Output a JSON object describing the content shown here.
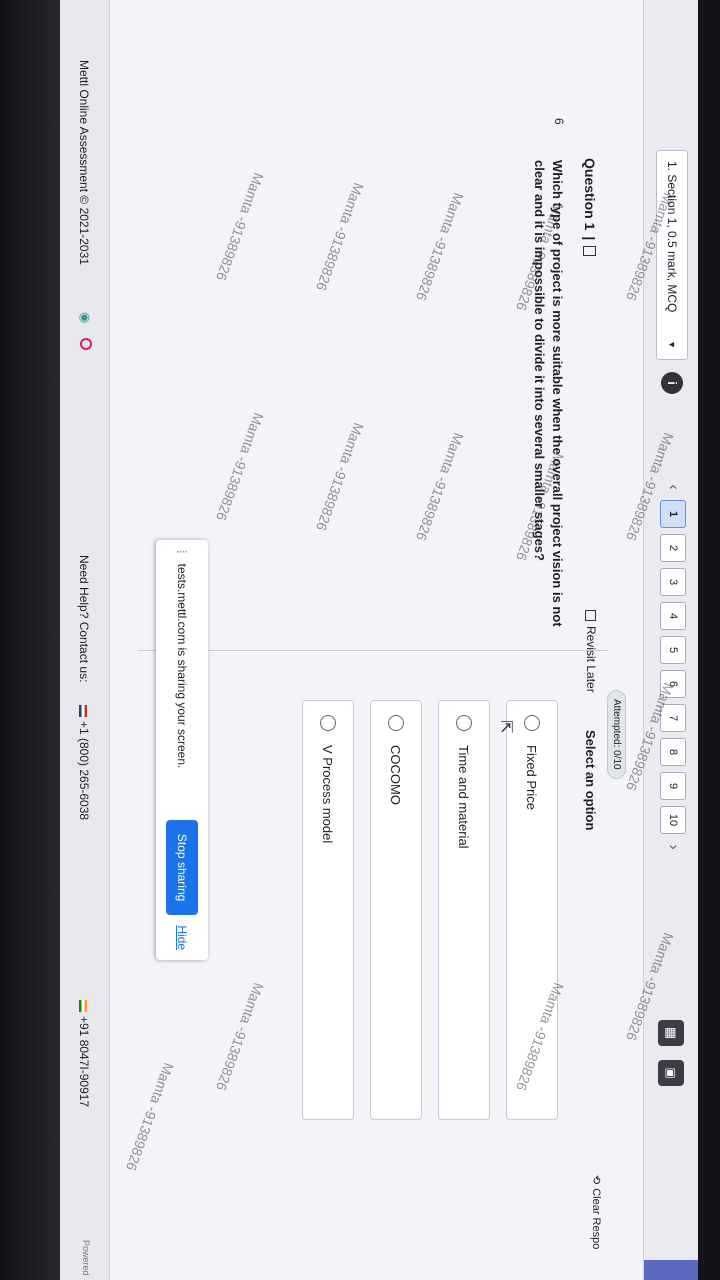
{
  "header": {
    "section_label": "1. Section 1, 0.5 mark, MCQ",
    "page_numbers": [
      "1",
      "2",
      "3",
      "4",
      "5",
      "6",
      "7",
      "8",
      "9",
      "10"
    ],
    "active_page": "1",
    "attempted": "Attempted: 0/10"
  },
  "question": {
    "label": "Question 1",
    "number": "6",
    "text": "Which type of project is more suitable when the overall project vision is not clear and it is impossible to divide it into several smaller stages?",
    "revisit_label": "Revisit Later",
    "select_label": "Select an option",
    "clear_label": "Clear Respo"
  },
  "options": [
    "Fixed Price",
    "Time and material",
    "COCOMO",
    "V Process model"
  ],
  "share_bar": {
    "message": "tests.mettl.com is sharing your screen.",
    "stop_label": "Stop sharing",
    "hide_label": "Hide"
  },
  "footer": {
    "copyright": "Mettl Online Assessment © 2021-2031",
    "help": "Need Help? Contact us:",
    "phone1": "+1 (800) 265-6038",
    "phone2": "+91 8047I-90917",
    "powered": "Powered"
  },
  "watermark": "Mamta -91389826"
}
